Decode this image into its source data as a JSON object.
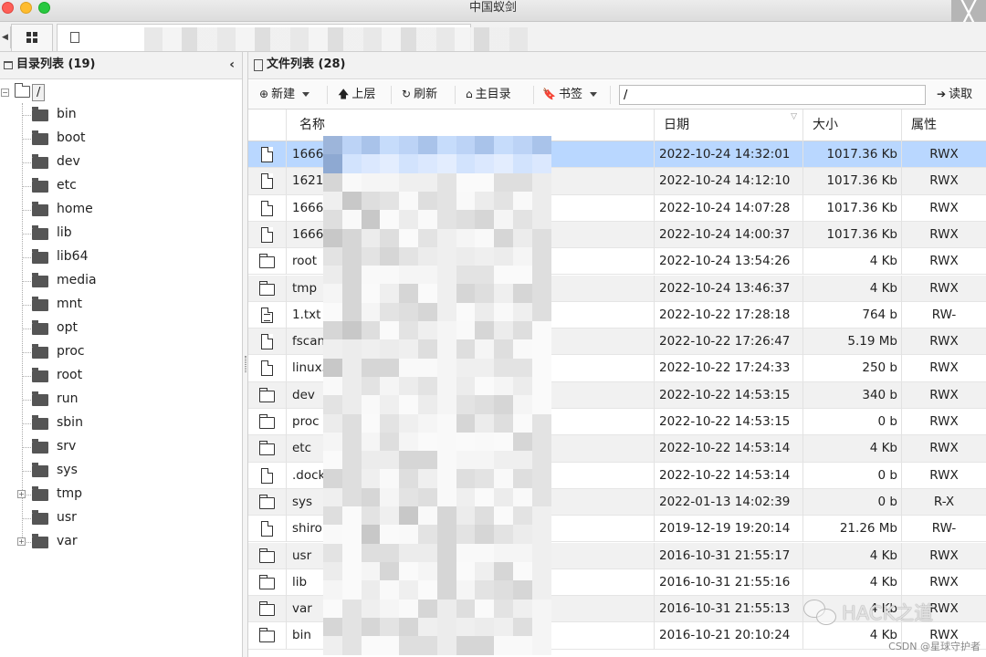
{
  "window": {
    "title": "中国蚁剑",
    "close_glyph": "╳"
  },
  "tabs": {
    "prev_arrow": "◀",
    "home_tab": "grid-icon",
    "file_tab": "file-icon"
  },
  "left_panel": {
    "title": "目录列表 (19)",
    "collapse_glyph": "‹",
    "root_label": "/",
    "root_expander": "−",
    "items": [
      {
        "name": "bin",
        "expandable": false
      },
      {
        "name": "boot",
        "expandable": false
      },
      {
        "name": "dev",
        "expandable": false
      },
      {
        "name": "etc",
        "expandable": false
      },
      {
        "name": "home",
        "expandable": false
      },
      {
        "name": "lib",
        "expandable": false
      },
      {
        "name": "lib64",
        "expandable": false
      },
      {
        "name": "media",
        "expandable": false
      },
      {
        "name": "mnt",
        "expandable": false
      },
      {
        "name": "opt",
        "expandable": false
      },
      {
        "name": "proc",
        "expandable": false
      },
      {
        "name": "root",
        "expandable": false
      },
      {
        "name": "run",
        "expandable": false
      },
      {
        "name": "sbin",
        "expandable": false
      },
      {
        "name": "srv",
        "expandable": false
      },
      {
        "name": "sys",
        "expandable": false
      },
      {
        "name": "tmp",
        "expandable": true
      },
      {
        "name": "usr",
        "expandable": false
      },
      {
        "name": "var",
        "expandable": true
      }
    ],
    "expander_plus": "+"
  },
  "right_panel": {
    "title": "文件列表 (28)",
    "toolbar": {
      "new_label": "新建",
      "up_label": "上层",
      "refresh_label": "刷新",
      "home_label": "主目录",
      "bookmark_label": "书签",
      "path_value": "/",
      "read_label": "读取",
      "icons": {
        "new": "⊕",
        "up": "🡅",
        "refresh": "↻",
        "home": "⌂",
        "bookmark": "🔖",
        "read": "➔"
      }
    },
    "columns": {
      "name": "名称",
      "date": "日期",
      "size": "大小",
      "attr": "属性",
      "sort_indicator": "▽"
    },
    "rows": [
      {
        "type": "file",
        "name": "1666",
        "date": "2022-10-24 14:32:01",
        "size": "1017.36 Kb",
        "attr": "RWX",
        "selected": true
      },
      {
        "type": "file",
        "name": "1621",
        "date": "2022-10-24 14:12:10",
        "size": "1017.36 Kb",
        "attr": "RWX"
      },
      {
        "type": "file",
        "name": "1666",
        "date": "2022-10-24 14:07:28",
        "size": "1017.36 Kb",
        "attr": "RWX"
      },
      {
        "type": "file",
        "name": "1666",
        "date": "2022-10-24 14:00:37",
        "size": "1017.36 Kb",
        "attr": "RWX"
      },
      {
        "type": "folder",
        "name": "root",
        "date": "2022-10-24 13:54:26",
        "size": "4 Kb",
        "attr": "RWX"
      },
      {
        "type": "folder",
        "name": "tmp",
        "date": "2022-10-24 13:46:37",
        "size": "4 Kb",
        "attr": "RWX"
      },
      {
        "type": "text",
        "name": "1.txt",
        "date": "2022-10-22 17:28:18",
        "size": "764 b",
        "attr": "RW-"
      },
      {
        "type": "file",
        "name": "fscan",
        "date": "2022-10-22 17:26:47",
        "size": "5.19 Mb",
        "attr": "RWX"
      },
      {
        "type": "file",
        "name": "linux5",
        "date": "2022-10-22 17:24:33",
        "size": "250 b",
        "attr": "RWX"
      },
      {
        "type": "folder",
        "name": "dev",
        "date": "2022-10-22 14:53:15",
        "size": "340 b",
        "attr": "RWX"
      },
      {
        "type": "folder",
        "name": "proc",
        "date": "2022-10-22 14:53:15",
        "size": "0 b",
        "attr": "RWX"
      },
      {
        "type": "folder",
        "name": "etc",
        "date": "2022-10-22 14:53:14",
        "size": "4 Kb",
        "attr": "RWX"
      },
      {
        "type": "file",
        "name": ".dock",
        "date": "2022-10-22 14:53:14",
        "size": "0 b",
        "attr": "RWX"
      },
      {
        "type": "folder",
        "name": "sys",
        "date": "2022-01-13 14:02:39",
        "size": "0 b",
        "attr": "R-X"
      },
      {
        "type": "file",
        "name": "shiro",
        "date": "2019-12-19 19:20:14",
        "size": "21.26 Mb",
        "attr": "RW-"
      },
      {
        "type": "folder",
        "name": "usr",
        "date": "2016-10-31 21:55:17",
        "size": "4 Kb",
        "attr": "RWX"
      },
      {
        "type": "folder",
        "name": "lib",
        "date": "2016-10-31 21:55:16",
        "size": "4 Kb",
        "attr": "RWX"
      },
      {
        "type": "folder",
        "name": "var",
        "date": "2016-10-31 21:55:13",
        "size": "4 Kb",
        "attr": "RWX"
      },
      {
        "type": "folder",
        "name": "bin",
        "date": "2016-10-21 20:10:24",
        "size": "4 Kb",
        "attr": "RWX"
      }
    ]
  },
  "overlay": {
    "watermark_text": "HACK之道",
    "credit_text": "CSDN @星球守护者"
  },
  "colors": {
    "selected_row": "#b9d7ff",
    "stripe_row": "#f1f1f1"
  }
}
